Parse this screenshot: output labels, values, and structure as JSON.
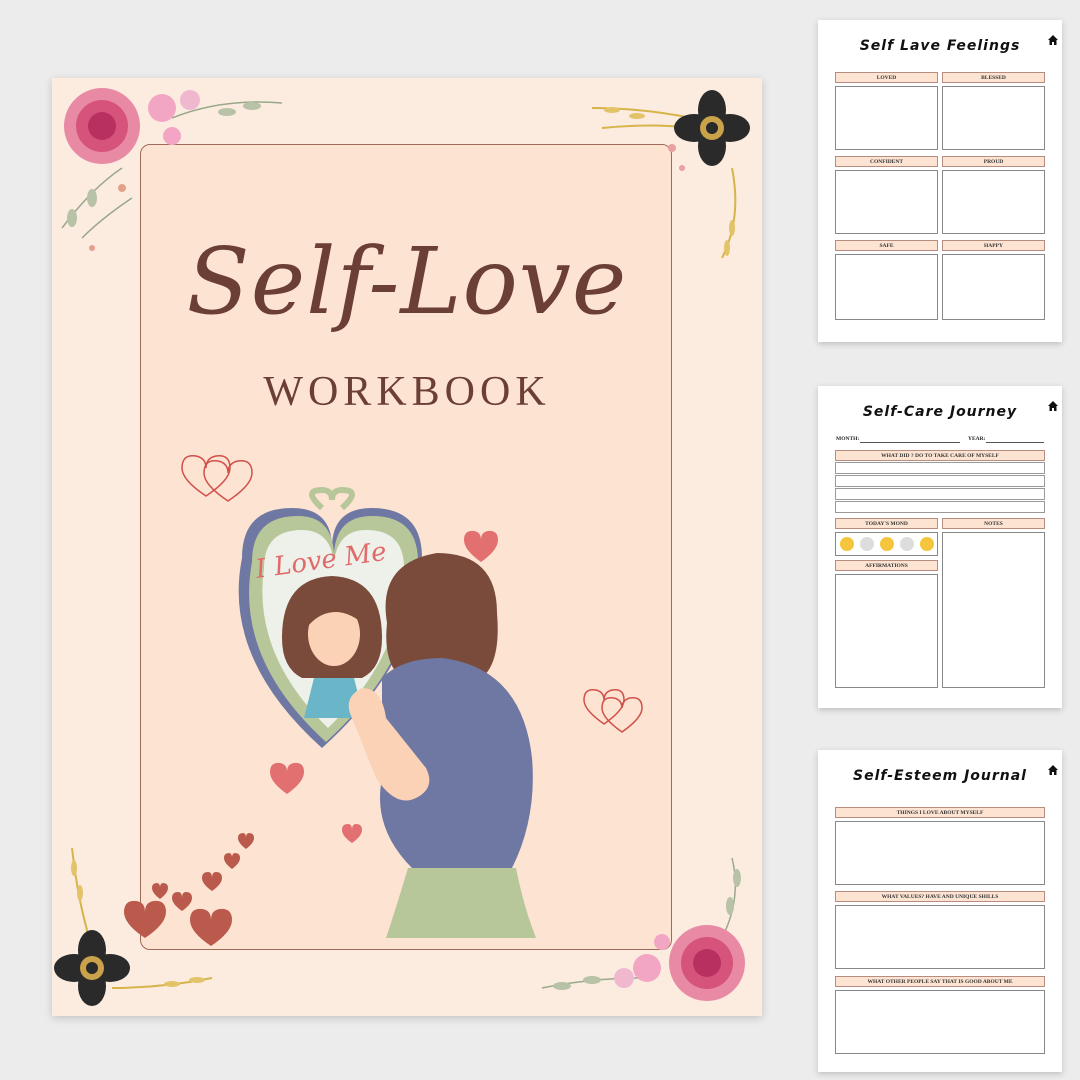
{
  "cover": {
    "title": "Self-Love",
    "subtitle": "WORKBOOK",
    "mirror_text": "I Love Me"
  },
  "page1": {
    "title": "Self Lave Feelings",
    "sections": [
      "LOVED",
      "BLESSED",
      "CONFIDENT",
      "PROUD",
      "SAFE",
      "HAPPY"
    ]
  },
  "page2": {
    "title": "Self-Care Journey",
    "month_label": "MONTH:",
    "year_label": "YEAR:",
    "section_care": "WHAT DID ? DO TO TAKE CARE OF MYSELF",
    "section_mood": "TODAY'S MOND",
    "section_notes": "NOTES",
    "section_affirmations": "AFFIRMATIONS"
  },
  "page3": {
    "title": "Self-Esteem Journal",
    "sections": [
      "THINGS I LOVE ABOUT MYSELF",
      "WHAT VALUES? HAVE AND UNIQUE SHILLS",
      "WHAT OTHER PEOPLE SAY THAT IS GOOD ABOUT ME"
    ]
  },
  "colors": {
    "background": "#ececec",
    "cover_bg": "#fcece0",
    "frame_bg": "#fde3d2",
    "title_brown": "#6b3e36",
    "header_peach": "#fde3d2",
    "heart_red": "#e27070"
  },
  "icons": [
    "home-icon",
    "rose-icon",
    "black-flower-icon",
    "heart-icon",
    "mood-face-icon"
  ]
}
